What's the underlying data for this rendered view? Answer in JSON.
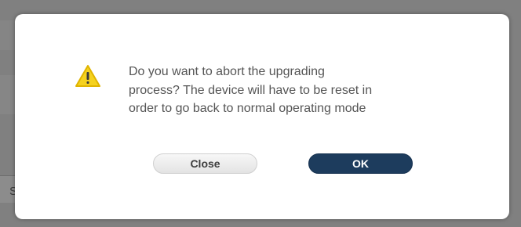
{
  "dialog": {
    "message_lines": [
      "Do you want to abort the upgrading",
      "process? The device will have to be reset in",
      "order to go back to normal operating mode"
    ],
    "icon": "warning-icon",
    "close_label": "Close",
    "ok_label": "OK"
  },
  "background": {
    "fragment_text": "S"
  },
  "colors": {
    "warning_fill": "#f5d21f",
    "ok_button": "#1d3c5d",
    "close_button": "#ececec",
    "text": "#555555"
  }
}
